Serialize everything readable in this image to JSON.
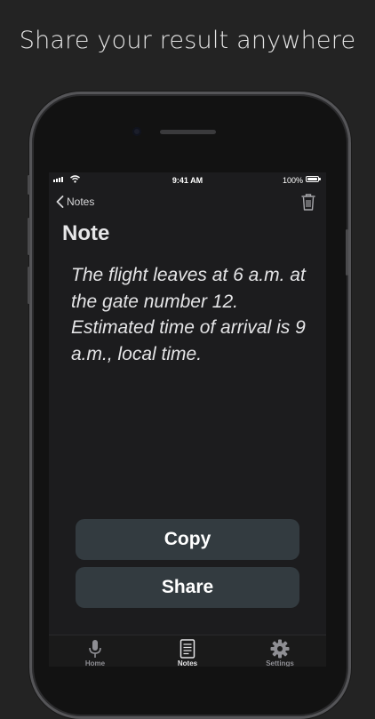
{
  "promo": {
    "headline": "Share your result anywhere"
  },
  "status_bar": {
    "time": "9:41 AM",
    "battery": "100%"
  },
  "nav": {
    "back_label": "Notes"
  },
  "note": {
    "title": "Note",
    "body": "The flight leaves at 6 a.m. at the gate number 12. Estimated time of arrival is 9 a.m., local time."
  },
  "actions": {
    "copy_label": "Copy",
    "share_label": "Share"
  },
  "tabs": [
    {
      "label": "Home",
      "icon": "microphone-icon"
    },
    {
      "label": "Notes",
      "icon": "notes-icon"
    },
    {
      "label": "Settings",
      "icon": "gear-icon"
    }
  ],
  "colors": {
    "background": "#232323",
    "screen": "#1c1c1e",
    "button": "#333b40",
    "active_tab": "#e5e5e7",
    "inactive_tab": "#8e8e93"
  }
}
